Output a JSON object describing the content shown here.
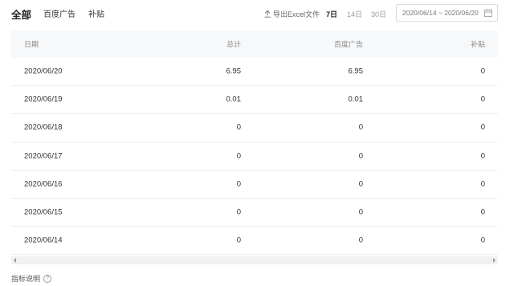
{
  "tabs": [
    {
      "label": "全部",
      "active": true
    },
    {
      "label": "百度广告",
      "active": false
    },
    {
      "label": "补贴",
      "active": false
    }
  ],
  "toolbar": {
    "export_label": "导出Excel文件",
    "export_icon": "upload-icon",
    "ranges": [
      {
        "label": "7日",
        "active": true
      },
      {
        "label": "14日",
        "active": false
      },
      {
        "label": "30日",
        "active": false
      }
    ],
    "date_range": "2020/06/14 ~ 2020/06/20",
    "date_icon": "calendar-icon"
  },
  "table": {
    "headers": [
      "日期",
      "总计",
      "百度广告",
      "补贴"
    ],
    "rows": [
      [
        "2020/06/20",
        "6.95",
        "6.95",
        "0"
      ],
      [
        "2020/06/19",
        "0.01",
        "0.01",
        "0"
      ],
      [
        "2020/06/18",
        "0",
        "0",
        "0"
      ],
      [
        "2020/06/17",
        "0",
        "0",
        "0"
      ],
      [
        "2020/06/16",
        "0",
        "0",
        "0"
      ],
      [
        "2020/06/15",
        "0",
        "0",
        "0"
      ],
      [
        "2020/06/14",
        "0",
        "0",
        "0"
      ]
    ]
  },
  "footer": {
    "note_label": "指标说明",
    "help_symbol": "?",
    "help_icon": "question-circle-icon"
  },
  "colors": {
    "header_bg": "#f7f8fa",
    "border": "#eeeeee",
    "scrollbar": "#f1f1f1"
  }
}
